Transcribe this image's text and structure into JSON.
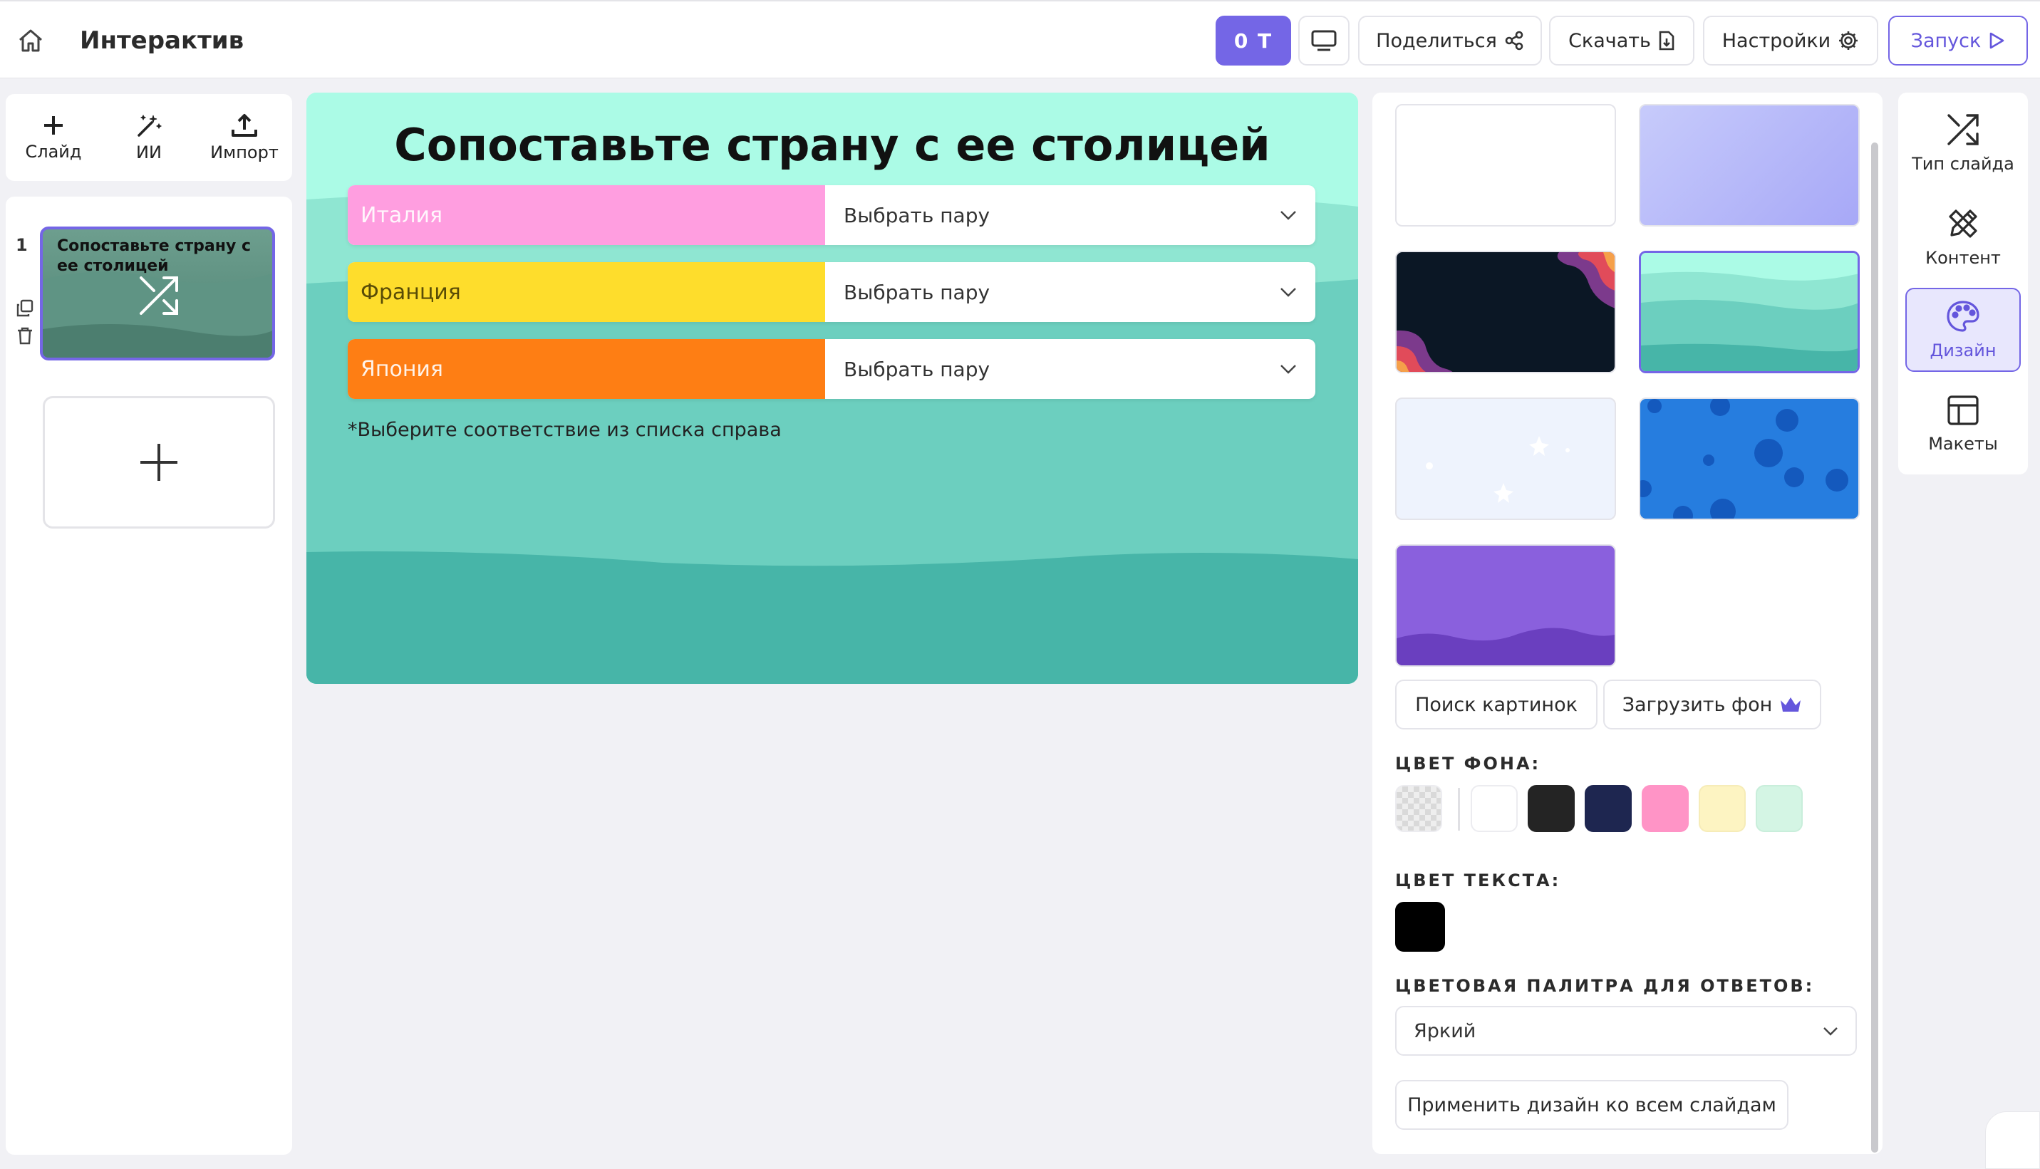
{
  "topbar": {
    "title": "Интерактив",
    "credits": "0 T",
    "share": "Поделиться",
    "download": "Скачать",
    "settings": "Настройки",
    "launch": "Запуск"
  },
  "left_tools": {
    "slide": "Слайд",
    "ai": "ИИ",
    "import": "Импорт"
  },
  "slides": [
    {
      "number": "1",
      "title": "Сопоставьте страну с ее столицей"
    }
  ],
  "canvas": {
    "title": "Сопоставьте страну с ее столицей",
    "pairs": [
      {
        "country": "Италия",
        "select": "Выбрать пару",
        "color": "#ff9ee0"
      },
      {
        "country": "Франция",
        "select": "Выбрать пару",
        "color": "#fedd2c"
      },
      {
        "country": "Япония",
        "select": "Выбрать пару",
        "color": "#fe7e14"
      }
    ],
    "note": "*Выберите соответствие из списка справа"
  },
  "design": {
    "backgrounds": [
      "white",
      "lavender-gradient",
      "dark-night",
      "teal-waves",
      "stars-light",
      "blue-dots",
      "purple-waves"
    ],
    "selected_background": "teal-waves",
    "search_images": "Поиск картинок",
    "upload_bg": "Загрузить фон",
    "bg_color_label": "ЦВЕТ ФОНА:",
    "bg_colors": [
      "transparent",
      "#ffffff",
      "#242424",
      "#1e2650",
      "#ff94c6",
      "#fdf4c2",
      "#d4f5e4"
    ],
    "text_color_label": "ЦВЕТ ТЕКСТА:",
    "text_color": "#000000",
    "palette_label": "ЦВЕТОВАЯ ПАЛИТРА ДЛЯ ОТВЕТОВ:",
    "palette_value": "Яркий",
    "apply_all": "Применить дизайн ко всем слайдам"
  },
  "right_rail": {
    "slide_type": "Тип слайда",
    "content": "Контент",
    "design": "Дизайн",
    "layouts": "Макеты"
  }
}
